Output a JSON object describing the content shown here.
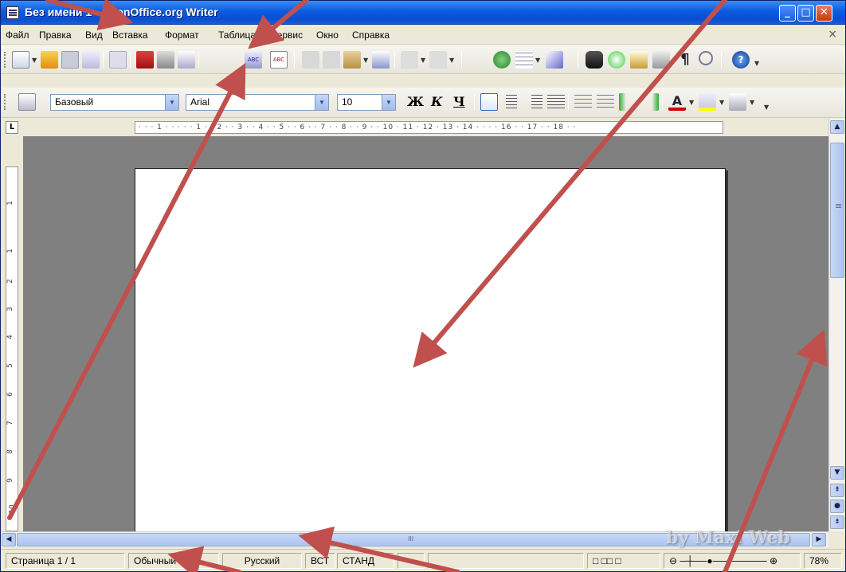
{
  "window": {
    "title": "Без имени 1 - OpenOffice.org Writer",
    "min_label": "_",
    "max_label": "□",
    "close_label": "✕"
  },
  "menu": [
    "Файл",
    "Правка",
    "Вид",
    "Вставка",
    "Формат",
    "Таблица",
    "Сервис",
    "Окно",
    "Справка"
  ],
  "menu_close": "×",
  "formatting": {
    "style": "Базовый",
    "font": "Arial",
    "size": "10",
    "bold": "Ж",
    "italic": "К",
    "underline": "Ч"
  },
  "ruler": {
    "tab_label": "L",
    "horizontal": "· · · 1 · · · · · 1 · · 2 · · 3 · · 4 · · 5 · · 6 · · 7 · · 8 · · 9 · · 10 · 11 · 12 · 13 · 14 · · · · 16 · · 17 · · 18 · ·",
    "vertical": [
      "1",
      "1",
      "2",
      "3",
      "4",
      "5",
      "6",
      "7",
      "8",
      "9",
      "10"
    ]
  },
  "status": {
    "page": "Страница  1 / 1",
    "style": "Обычный",
    "language": "Русский",
    "insert": "ВСТ",
    "select": "СТАНД",
    "zoom": "78%"
  },
  "watermark": "by Maxi Web",
  "colors": {
    "arrow": "#c0504d",
    "desktop": "#808080"
  }
}
